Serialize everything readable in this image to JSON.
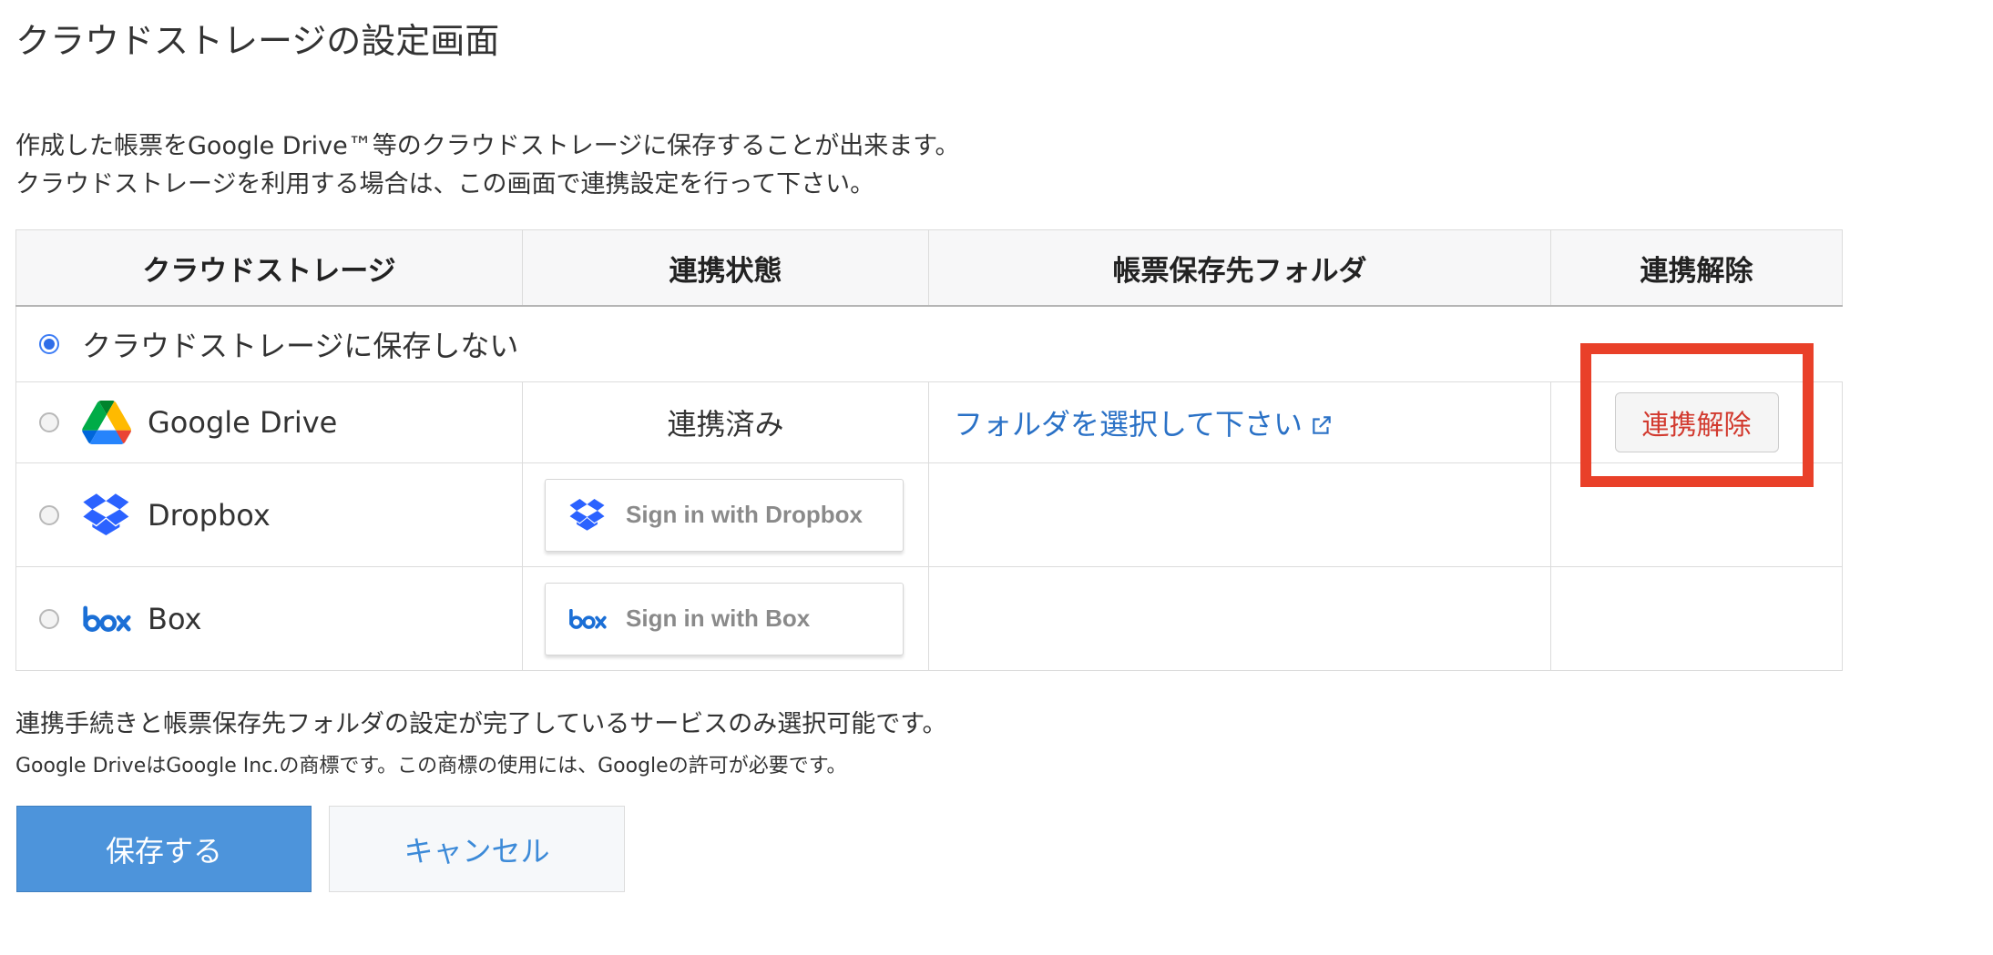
{
  "page": {
    "title": "クラウドストレージの設定画面",
    "description": [
      "作成した帳票をGoogle Drive™等のクラウドストレージに保存することが出来ます。",
      "クラウドストレージを利用する場合は、この画面で連携設定を行って下さい。"
    ]
  },
  "table": {
    "headers": [
      "クラウドストレージ",
      "連携状態",
      "帳票保存先フォルダ",
      "連携解除"
    ],
    "no_storage_label": "クラウドストレージに保存しない",
    "rows": [
      {
        "name": "Google Drive",
        "icon": "google-drive-icon",
        "status": "連携済み",
        "folder_link": "フォルダを選択して下さい",
        "unlink_label": "連携解除",
        "selected": false
      },
      {
        "name": "Dropbox",
        "icon": "dropbox-icon",
        "signin_label": "Sign in with Dropbox",
        "selected": false
      },
      {
        "name": "Box",
        "icon": "box-icon",
        "signin_label": "Sign in with Box",
        "selected": false
      }
    ]
  },
  "notes": {
    "availability": "連携手続きと帳票保存先フォルダの設定が完了しているサービスのみ選択可能です。",
    "trademark": "Google DriveはGoogle Inc.の商標です。この商標の使用には、Googleの許可が必要です。"
  },
  "actions": {
    "save_label": "保存する",
    "cancel_label": "キャンセル"
  },
  "colors": {
    "highlight": "#e94029",
    "primary": "#4d94db",
    "link": "#2a71c6",
    "danger_text": "#d23a2f"
  }
}
